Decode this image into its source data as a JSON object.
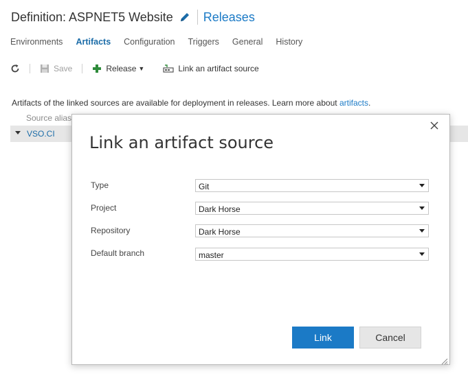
{
  "header": {
    "title": "Definition: ASPNET5 Website",
    "releases_link": "Releases"
  },
  "tabs": [
    {
      "label": "Environments",
      "active": false
    },
    {
      "label": "Artifacts",
      "active": true
    },
    {
      "label": "Configuration",
      "active": false
    },
    {
      "label": "Triggers",
      "active": false
    },
    {
      "label": "General",
      "active": false
    },
    {
      "label": "History",
      "active": false
    }
  ],
  "toolbar": {
    "save_label": "Save",
    "release_label": "Release",
    "link_label": "Link an artifact source"
  },
  "content": {
    "info_text": "Artifacts of the linked sources are available for deployment in releases. Learn more about ",
    "info_link": "artifacts",
    "info_end": ".",
    "grid_header": "Source alias",
    "grid_row_label": "VSO.CI"
  },
  "dialog": {
    "title": "Link an artifact source",
    "fields": [
      {
        "label": "Type",
        "value": "Git"
      },
      {
        "label": "Project",
        "value": "Dark Horse"
      },
      {
        "label": "Repository",
        "value": "Dark Horse"
      },
      {
        "label": "Default branch",
        "value": "master"
      }
    ],
    "link_button": "Link",
    "cancel_button": "Cancel"
  },
  "colors": {
    "accent": "#1b7ac6",
    "plus_icon": "#2e8b3a"
  },
  "icons": {
    "edit": "pencil-icon",
    "refresh": "refresh-icon",
    "save": "save-icon",
    "release": "plus-icon",
    "link": "link-artifact-icon",
    "close": "close-icon"
  }
}
